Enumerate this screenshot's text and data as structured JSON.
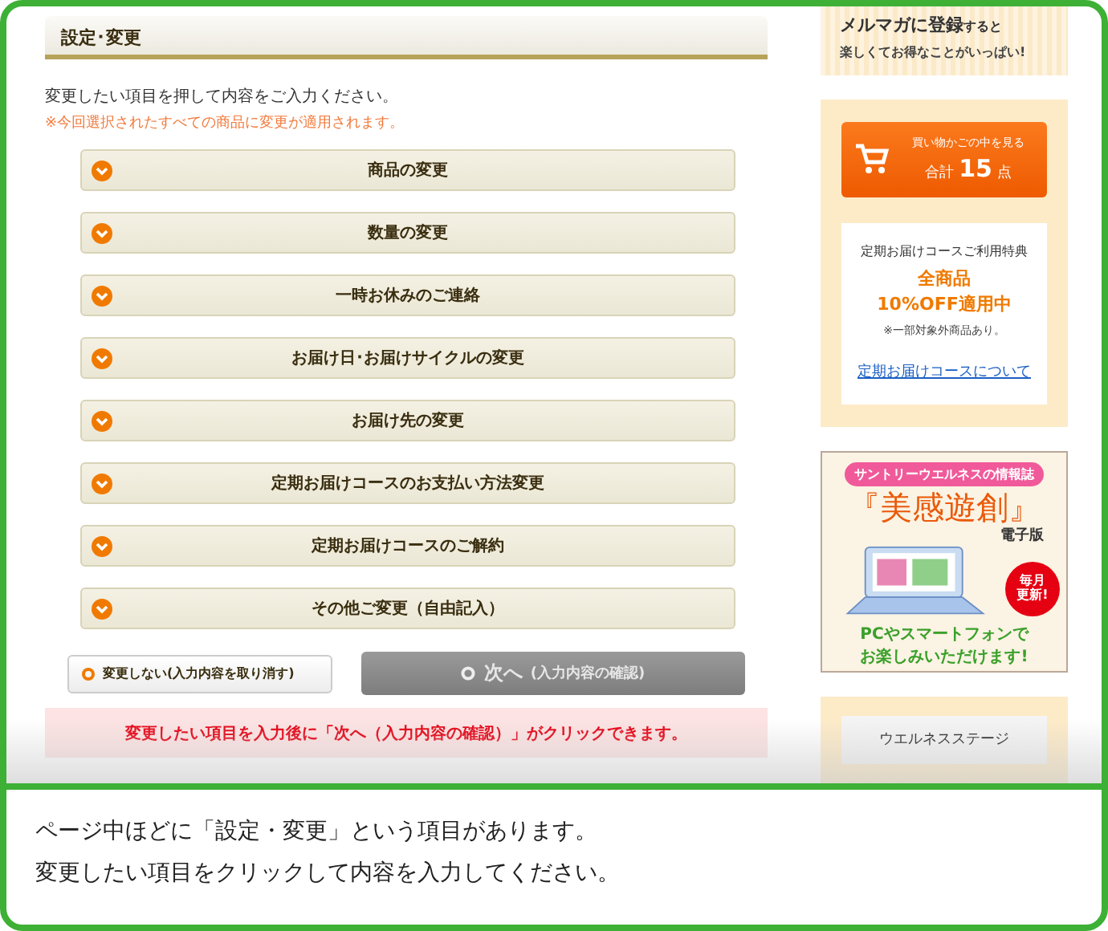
{
  "section": {
    "title": "設定･変更",
    "instruction": "変更したい項目を押して内容をご入力ください。",
    "note": "※今回選択されたすべての商品に変更が適用されます。"
  },
  "change_items": [
    "商品の変更",
    "数量の変更",
    "一時お休みのご連絡",
    "お届け日･お届けサイクルの変更",
    "お届け先の変更",
    "定期お届けコースのお支払い方法変更",
    "定期お届けコースのご解約",
    "その他ご変更（自由記入）"
  ],
  "cancel_button": {
    "label": "変更しない(入力内容を取り消す)"
  },
  "next_button": {
    "label": "次へ",
    "sub": "(入力内容の確認)",
    "disabled": true
  },
  "notice": "変更したい項目を入力後に「次へ（入力内容の確認）」がクリックできます。",
  "sidebar": {
    "newsletter": {
      "bold": "メルマガに登録",
      "rest": "すると",
      "line2": "楽しくてお得なことがいっぱい!"
    },
    "cart": {
      "label": "買い物かごの中を見る",
      "prefix": "合計",
      "count": "15",
      "unit": "点"
    },
    "benefit": {
      "heading": "定期お届けコースご利用特典",
      "highlight": [
        "全商品",
        "10%OFF適用中"
      ],
      "note": "※一部対象外商品あり。",
      "link": "定期お届けコースについて"
    },
    "magazine": {
      "tag": "サントリーウエルネスの情報誌",
      "title": "『美感遊創』",
      "edition": "電子版",
      "badge": [
        "毎月",
        "更新!"
      ],
      "lines": [
        "PCやスマートフォンで",
        "お楽しみいただけます!"
      ]
    },
    "stage": "ウエルネスステージ"
  },
  "caption": [
    "ページ中ほどに「設定・変更」という項目があります。",
    "変更したい項目をクリックして内容を入力してください。"
  ]
}
